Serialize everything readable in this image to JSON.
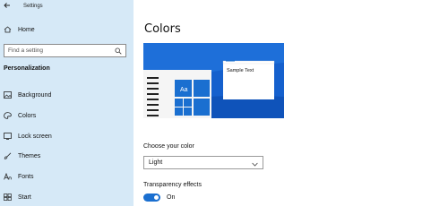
{
  "window": {
    "title": "Settings"
  },
  "sidebar": {
    "home_label": "Home",
    "search_placeholder": "Find a setting",
    "section_title": "Personalization",
    "items": [
      {
        "label": "Background",
        "icon": "image-icon"
      },
      {
        "label": "Colors",
        "icon": "palette-icon"
      },
      {
        "label": "Lock screen",
        "icon": "lock-screen-icon"
      },
      {
        "label": "Themes",
        "icon": "brush-icon"
      },
      {
        "label": "Fonts",
        "icon": "font-icon"
      },
      {
        "label": "Start",
        "icon": "start-icon"
      }
    ]
  },
  "main": {
    "title": "Colors",
    "preview": {
      "sample_text": "Sample Text",
      "tile_label": "Aa"
    },
    "choose_color": {
      "label": "Choose your color",
      "value": "Light"
    },
    "transparency": {
      "label": "Transparency effects",
      "state_label": "On",
      "enabled": true
    }
  },
  "colors": {
    "accent": "#1a6fd0",
    "sidebar_bg": "#d6e9f7",
    "preview_bg": "#1e6fd9"
  }
}
